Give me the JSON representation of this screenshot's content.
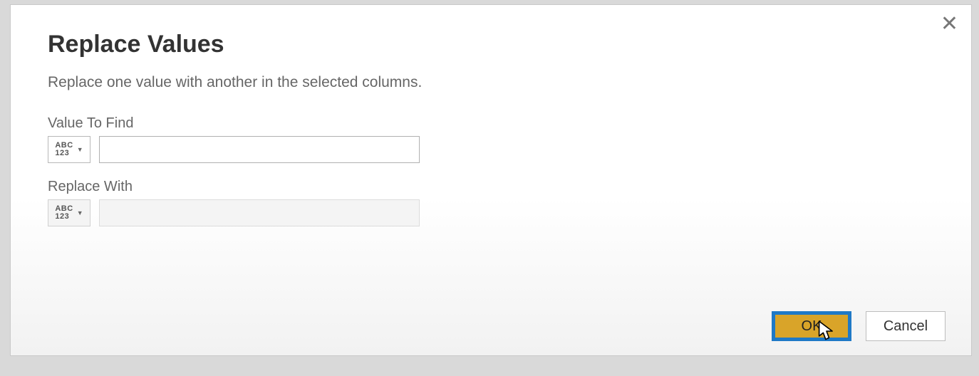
{
  "dialog": {
    "title": "Replace Values",
    "subtitle": "Replace one value with another in the selected columns.",
    "close_glyph": "✕",
    "fields": {
      "find": {
        "label": "Value To Find",
        "type_abc": "ABC",
        "type_123": "123",
        "value": ""
      },
      "replace": {
        "label": "Replace With",
        "type_abc": "ABC",
        "type_123": "123",
        "value": ""
      }
    },
    "buttons": {
      "ok": "OK",
      "cancel": "Cancel"
    }
  }
}
